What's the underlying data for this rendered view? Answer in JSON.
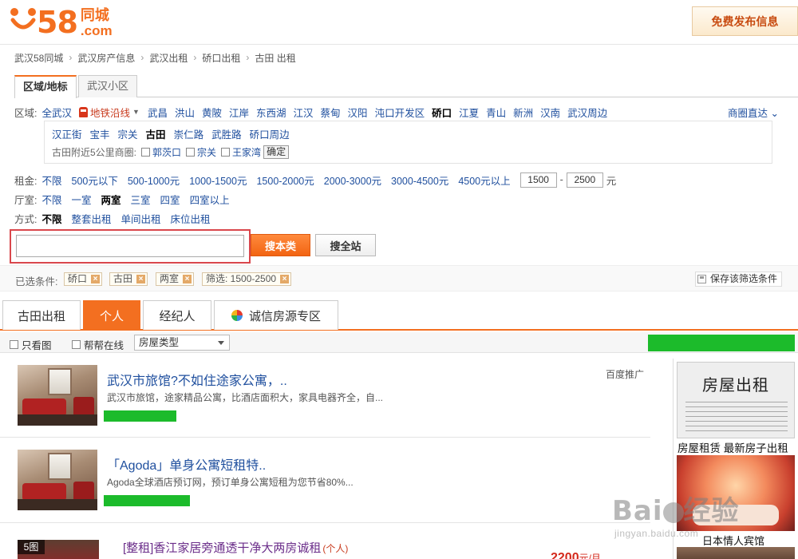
{
  "header": {
    "logo_number": "58",
    "logo_cn": "同城",
    "logo_com": ".com",
    "publish_label": "免费发布信息"
  },
  "breadcrumb": [
    "武汉58同城",
    "武汉房产信息",
    "武汉出租",
    "硚口出租",
    "古田 出租"
  ],
  "area_tabs": [
    "区域/地标",
    "武汉小区"
  ],
  "filters": {
    "district_label": "区域:",
    "district_all": "全武汉",
    "subway_label": "地铁沿线",
    "districts": [
      "武昌",
      "洪山",
      "黄陂",
      "江岸",
      "东西湖",
      "江汉",
      "蔡甸",
      "汉阳",
      "沌口开发区",
      "硚口",
      "江夏",
      "青山",
      "新洲",
      "汉南",
      "武汉周边"
    ],
    "district_selected": "硚口",
    "business_link": "商圈直达 ⌄",
    "streets": [
      "汉正街",
      "宝丰",
      "宗关",
      "古田",
      "崇仁路",
      "武胜路",
      "硚口周边"
    ],
    "street_selected": "古田",
    "nearby_label": "古田附近5公里商圈:",
    "nearby_options": [
      "郭茨口",
      "宗关",
      "王家湾"
    ],
    "confirm_label": "确定",
    "rent_label": "租金:",
    "rent_options": [
      "不限",
      "500元以下",
      "500-1000元",
      "1000-1500元",
      "1500-2000元",
      "2000-3000元",
      "3000-4500元",
      "4500元以上"
    ],
    "rent_min": "1500",
    "rent_max": "2500",
    "rent_unit": "元",
    "room_label": "厅室:",
    "room_options": [
      "不限",
      "一室",
      "两室",
      "三室",
      "四室",
      "四室以上"
    ],
    "room_selected": "两室",
    "mode_label": "方式:",
    "mode_options": [
      "不限",
      "整套出租",
      "单间出租",
      "床位出租"
    ],
    "mode_selected": "不限"
  },
  "search": {
    "value": "",
    "local_label": "搜本类",
    "site_label": "搜全站"
  },
  "chosen": {
    "label": "已选条件:",
    "tags": [
      "硚口",
      "古田",
      "两室",
      "筛选: 1500-2500"
    ],
    "save_label": "保存该筛选条件"
  },
  "list_tabs": [
    "古田出租",
    "个人",
    "经纪人",
    "诚信房源专区"
  ],
  "active_list_tab": "个人",
  "toolbar": {
    "photo_only": "只看图",
    "online": "帮帮在线",
    "type_select": "房屋类型"
  },
  "ad_label": "百度推广",
  "listings": [
    {
      "title": "武汉市旅馆?不如住途家公寓，..",
      "desc": "武汉市旅馆，途家精品公寓，比酒店面积大，家具电器齐全，自..."
    },
    {
      "title": "「Agoda」单身公寓短租特..",
      "desc": "Agoda全球酒店预订网，预订单身公寓短租为您节省80%..."
    },
    {
      "title": "[整租]香江家居旁通透干净大两房诚租",
      "tag": "(个人)",
      "photo_count": "5图",
      "price": "2200",
      "price_unit": "元/月"
    }
  ],
  "right_ads": [
    {
      "image_text": "房屋出租",
      "caption": "房屋租赁 最新房子出租"
    },
    {
      "caption": "日本情人宾馆"
    }
  ],
  "watermark": {
    "brand": "Bai",
    "brand2": "经验",
    "url": "jingyan.baidu.com"
  },
  "colors": {
    "accent": "#f36f20",
    "link": "#1f4f9e",
    "highlight_frame": "#d9474c",
    "green": "#1cbb2b",
    "price": "#d4291c"
  }
}
